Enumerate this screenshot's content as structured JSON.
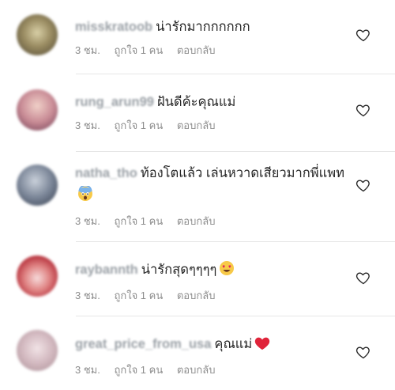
{
  "comments": [
    {
      "username": "misskratoob",
      "text": "น่ารักมากกกกกก",
      "emoji": "",
      "time": "3 ชม.",
      "likes": "ถูกใจ 1 คน",
      "reply": "ตอบกลับ",
      "avatar_colors": [
        "#d8cfa6",
        "#6b5f3f"
      ]
    },
    {
      "username": "rung_arun99",
      "text": "ฝันดีค้ะคุณแม่",
      "emoji": "",
      "time": "3 ชม.",
      "likes": "ถูกใจ 1 คน",
      "reply": "ตอบกลับ",
      "avatar_colors": [
        "#e8b9b3",
        "#8c5d6a"
      ]
    },
    {
      "username": "natha_tho",
      "text": "ท้องโตแล้ว เล่นหวาดเสียวมากพี่แพท",
      "emoji": "fearful-face",
      "time": "3 ชม.",
      "likes": "ถูกใจ 1 คน",
      "reply": "ตอบกลับ",
      "avatar_colors": [
        "#b8c2d0",
        "#4b5568"
      ]
    },
    {
      "username": "raybannth",
      "text": "น่ารักสุดๆๆๆๆ",
      "emoji": "heart-eyes",
      "time": "3 ชม.",
      "likes": "ถูกใจ 1 คน",
      "reply": "ตอบกลับ",
      "avatar_colors": [
        "#f2c7c7",
        "#c23b3b"
      ]
    },
    {
      "username": "great_price_from_usa",
      "text": "คุณแม่",
      "emoji": "red-heart",
      "time": "3 ชม.",
      "likes": "ถูกใจ 1 คน",
      "reply": "ตอบกลับ",
      "avatar_colors": [
        "#e9d6da",
        "#b9a2a8"
      ]
    }
  ]
}
